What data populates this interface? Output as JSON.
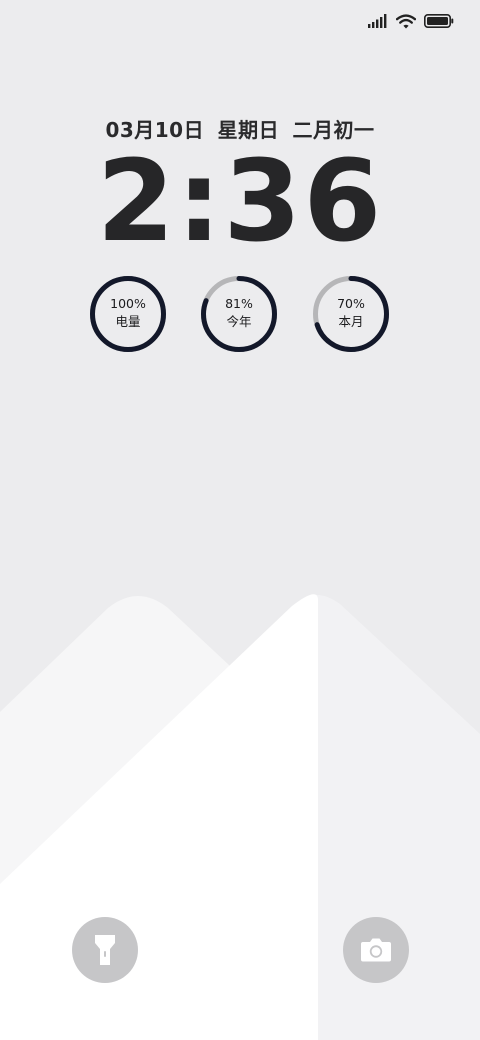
{
  "status_bar": {
    "signal_icon": "cellular-signal-icon",
    "wifi_icon": "wifi-icon",
    "battery_icon": "battery-icon"
  },
  "lockscreen": {
    "date": "03月10日",
    "weekday": "星期日",
    "lunar_date": "二月初一",
    "time": "2:36"
  },
  "rings": [
    {
      "value": "100%",
      "label": "电量",
      "progress": 1.0
    },
    {
      "value": "81%",
      "label": "今年",
      "progress": 0.81
    },
    {
      "value": "70%",
      "label": "本月",
      "progress": 0.7
    }
  ],
  "colors": {
    "ring_fill": "#13182a",
    "ring_track": "#b6b6b8",
    "shortcut_bg": "#c6c6c8",
    "text": "#262628"
  },
  "shortcuts": {
    "left_icon": "flashlight-icon",
    "right_icon": "camera-icon"
  }
}
